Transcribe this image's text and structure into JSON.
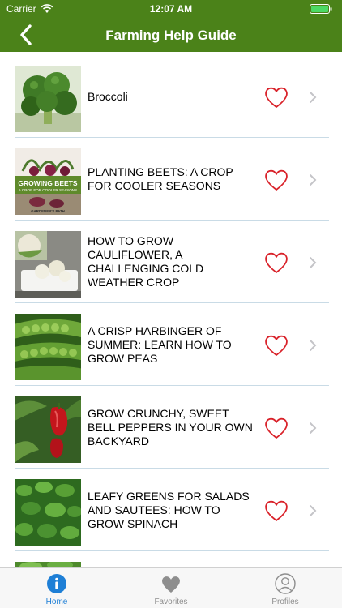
{
  "status_bar": {
    "carrier": "Carrier",
    "time": "12:07 AM"
  },
  "nav": {
    "title": "Farming Help Guide",
    "back_icon": "chevron-left-icon"
  },
  "colors": {
    "nav_bg": "#4b8219",
    "accent": "#1e7fd6",
    "heart": "#d9222a",
    "tab_inactive": "#8e8e8e"
  },
  "articles": [
    {
      "title": "Broccoli",
      "image": "broccoli"
    },
    {
      "title": "PLANTING BEETS: A CROP FOR COOLER SEASONS",
      "image": "beets"
    },
    {
      "title": "HOW TO GROW CAULIFLOWER, A CHALLENGING COLD WEATHER CROP",
      "image": "cauliflower"
    },
    {
      "title": "A CRISP HARBINGER OF SUMMER: LEARN HOW TO GROW PEAS",
      "image": "peas"
    },
    {
      "title": "GROW CRUNCHY, SWEET BELL PEPPERS IN YOUR OWN BACKYARD",
      "image": "peppers"
    },
    {
      "title": "LEAFY GREENS FOR SALADS AND SAUTEES: HOW TO GROW SPINACH",
      "image": "spinach"
    }
  ],
  "beets_image_text": {
    "line1": "GROWING BEETS",
    "line2": "A CROP FOR COOLER SEASONS",
    "footer": "GARDENER'S PATH"
  },
  "tabs": [
    {
      "label": "Home",
      "icon": "info-icon",
      "active": true
    },
    {
      "label": "Favorites",
      "icon": "heart-icon",
      "active": false
    },
    {
      "label": "Profiles",
      "icon": "person-icon",
      "active": false
    }
  ]
}
